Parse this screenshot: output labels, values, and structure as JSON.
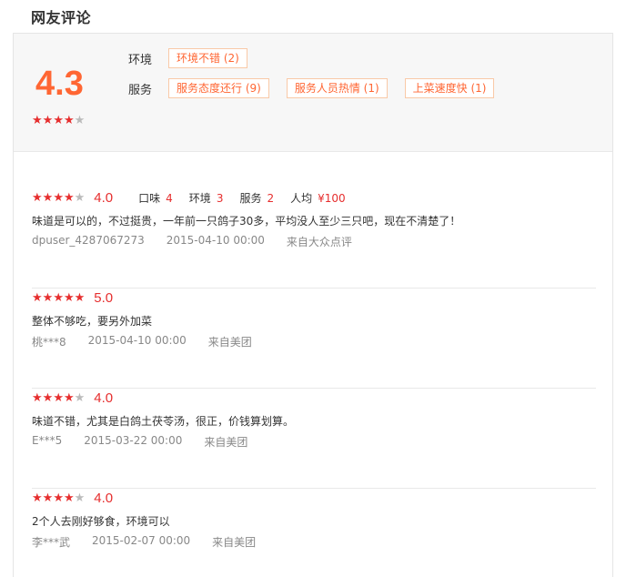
{
  "section_title": "网友评论",
  "summary": {
    "score": "4.3",
    "stars_filled": 4,
    "star_icon_name": "star-icon",
    "tag_groups": [
      {
        "label": "环境",
        "tags": [
          "环境不错 (2)"
        ]
      },
      {
        "label": "服务",
        "tags": [
          "服务态度还行 (9)",
          "服务人员热情 (1)",
          "上菜速度快 (1)"
        ]
      }
    ]
  },
  "reviews": [
    {
      "stars_filled": 4,
      "score": "4.0",
      "subscores": [
        {
          "label": "口味",
          "value": "4"
        },
        {
          "label": "环境",
          "value": "3"
        },
        {
          "label": "服务",
          "value": "2"
        },
        {
          "label": "人均",
          "value": "¥100"
        }
      ],
      "text": "味道是可以的，不过挺贵，一年前一只鸽子30多，平均没人至少三只吧，现在不清楚了！",
      "user": "dpuser_4287067273",
      "date": "2015-04-10 00:00",
      "source": "来自大众点评"
    },
    {
      "stars_filled": 5,
      "score": "5.0",
      "subscores": [],
      "text": "整体不够吃，要另外加菜",
      "user": "桃***8",
      "date": "2015-04-10 00:00",
      "source": "来自美团"
    },
    {
      "stars_filled": 4,
      "score": "4.0",
      "subscores": [],
      "text": "味道不错，尤其是白鸽土茯苓汤，很正，价钱算划算。",
      "user": "E***5",
      "date": "2015-03-22 00:00",
      "source": "来自美团"
    },
    {
      "stars_filled": 4,
      "score": "4.0",
      "subscores": [],
      "text": "2个人去刚好够食，环境可以",
      "user": "李***武",
      "date": "2015-02-07 00:00",
      "source": "来自美团"
    }
  ],
  "colors": {
    "accent": "#ff6633",
    "star_red": "#e62e2e",
    "star_gray": "#bbbbbb"
  }
}
